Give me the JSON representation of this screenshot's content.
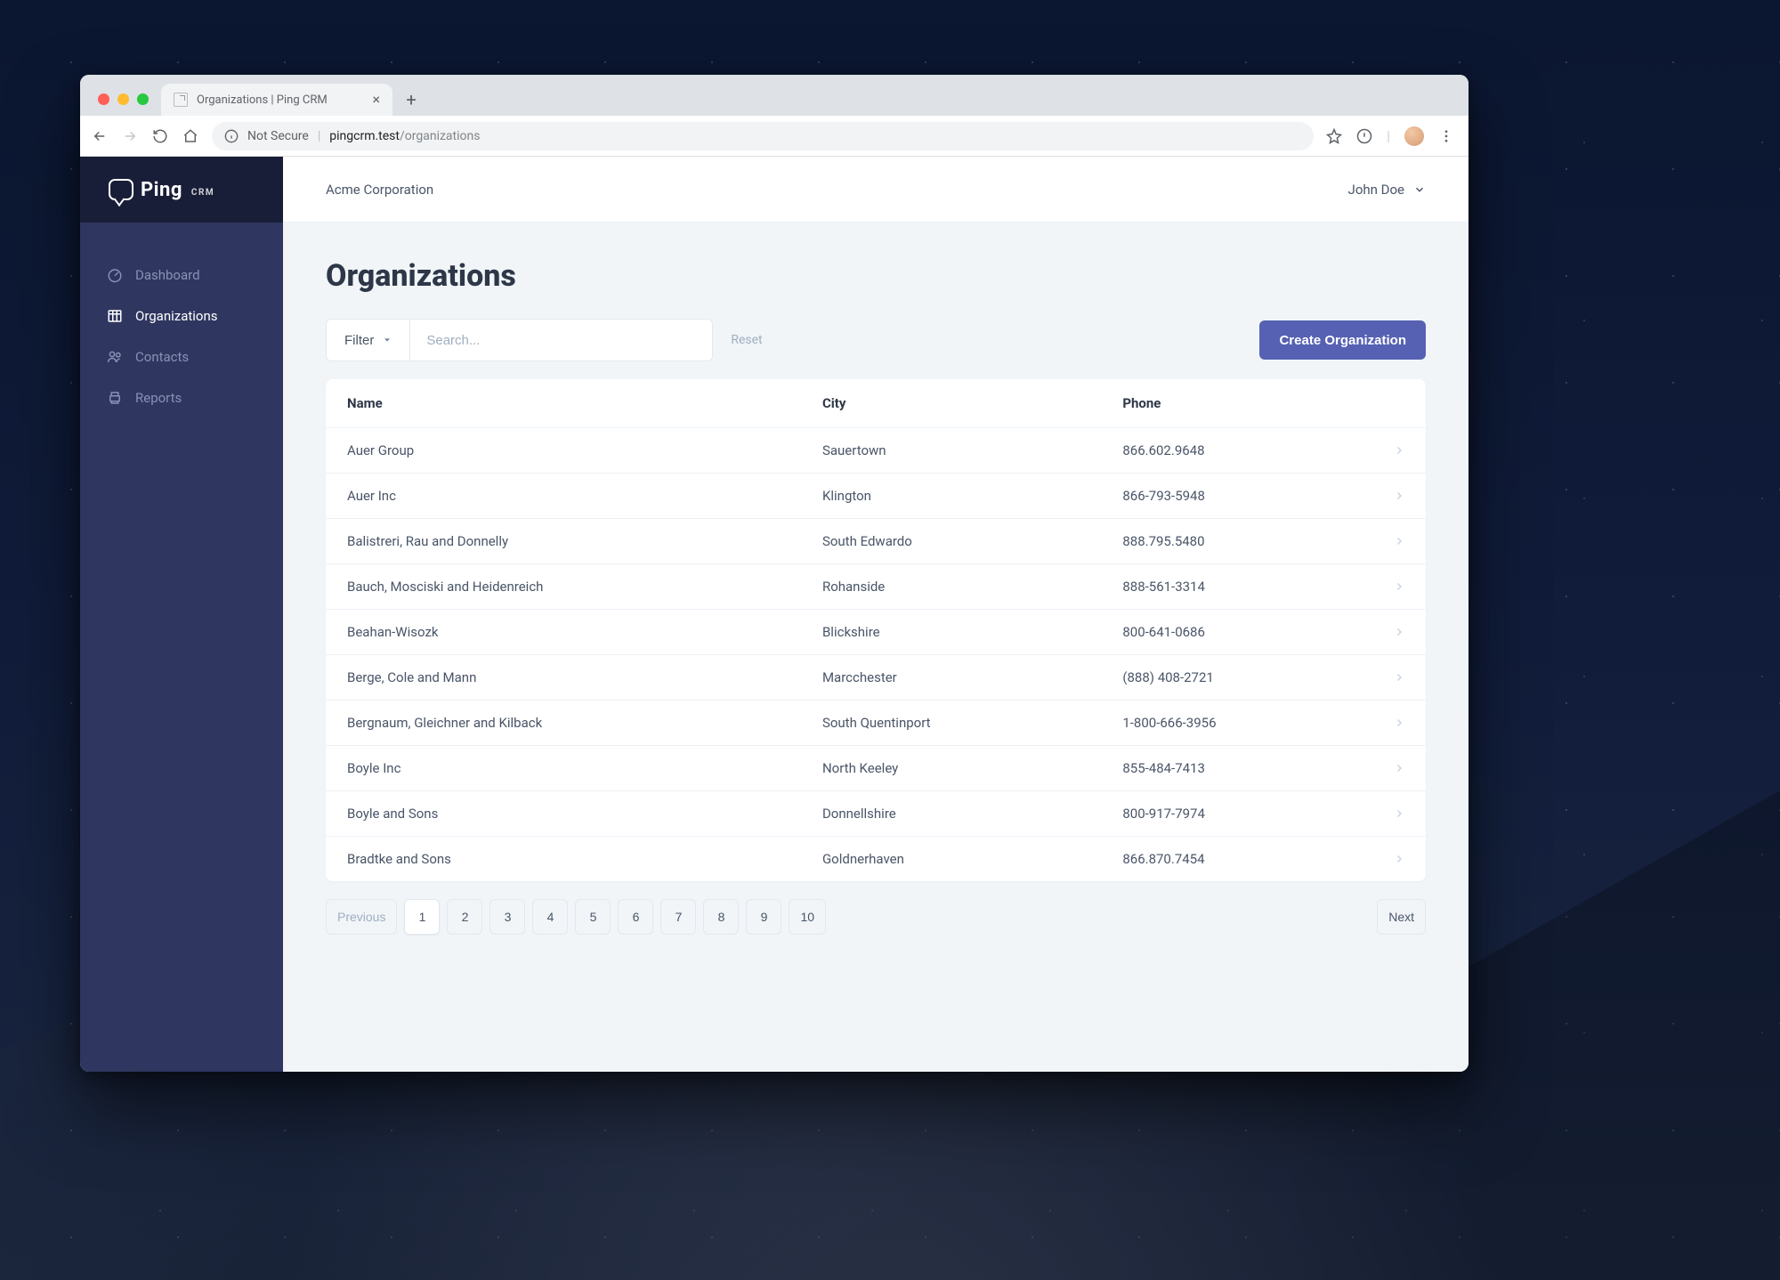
{
  "browser": {
    "tab_title": "Organizations | Ping CRM",
    "url_insecure_label": "Not Secure",
    "url_host": "pingcrm.test",
    "url_path": "/organizations"
  },
  "brand": {
    "name": "Ping",
    "sub": "CRM"
  },
  "sidebar": {
    "items": [
      {
        "label": "Dashboard",
        "icon": "gauge-icon",
        "active": false
      },
      {
        "label": "Organizations",
        "icon": "grid-icon",
        "active": true
      },
      {
        "label": "Contacts",
        "icon": "users-icon",
        "active": false
      },
      {
        "label": "Reports",
        "icon": "printer-icon",
        "active": false
      }
    ]
  },
  "topbar": {
    "org_name": "Acme Corporation",
    "user_name": "John Doe"
  },
  "page": {
    "title": "Organizations",
    "filter_label": "Filter",
    "search_placeholder": "Search...",
    "reset_label": "Reset",
    "create_label": "Create Organization"
  },
  "table": {
    "columns": {
      "name": "Name",
      "city": "City",
      "phone": "Phone"
    },
    "rows": [
      {
        "name": "Auer Group",
        "city": "Sauertown",
        "phone": "866.602.9648"
      },
      {
        "name": "Auer Inc",
        "city": "Klington",
        "phone": "866-793-5948"
      },
      {
        "name": "Balistreri, Rau and Donnelly",
        "city": "South Edwardo",
        "phone": "888.795.5480"
      },
      {
        "name": "Bauch, Mosciski and Heidenreich",
        "city": "Rohanside",
        "phone": "888-561-3314"
      },
      {
        "name": "Beahan-Wisozk",
        "city": "Blickshire",
        "phone": "800-641-0686"
      },
      {
        "name": "Berge, Cole and Mann",
        "city": "Marcchester",
        "phone": "(888) 408-2721"
      },
      {
        "name": "Bergnaum, Gleichner and Kilback",
        "city": "South Quentinport",
        "phone": "1-800-666-3956"
      },
      {
        "name": "Boyle Inc",
        "city": "North Keeley",
        "phone": "855-484-7413"
      },
      {
        "name": "Boyle and Sons",
        "city": "Donnellshire",
        "phone": "800-917-7974"
      },
      {
        "name": "Bradtke and Sons",
        "city": "Goldnerhaven",
        "phone": "866.870.7454"
      }
    ]
  },
  "pagination": {
    "previous": "Previous",
    "next": "Next",
    "pages": [
      "1",
      "2",
      "3",
      "4",
      "5",
      "6",
      "7",
      "8",
      "9",
      "10"
    ],
    "current": "1"
  }
}
